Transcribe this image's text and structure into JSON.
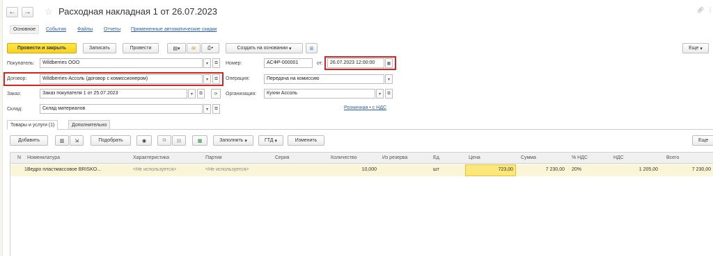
{
  "window": {
    "title": "Расходная накладная 1 от 26.07.2023"
  },
  "tabs": [
    "Основное",
    "События",
    "Файлы",
    "Отчеты",
    "Примененные автоматические скидки"
  ],
  "toolbar": {
    "post_close": "Провести и закрыть",
    "save": "Записать",
    "post": "Провести",
    "create_based": "Создать на основании",
    "more": "Еще"
  },
  "form": {
    "buyer_label": "Покупатель:",
    "buyer_value": "Wildberries ООО",
    "number_label": "Номер:",
    "number_value": "АСФР-000001",
    "from_label": "от:",
    "date_value": "26.07.2023 12:00:00",
    "contract_label": "Договор:",
    "contract_value": "Wildberries-Ассоль (договор с комиссионером)",
    "operation_label": "Операция:",
    "operation_value": "Передача на комиссию",
    "order_label": "Заказ:",
    "order_value": "Заказ покупателя 1 от 25.07.2023",
    "org_label": "Организация:",
    "org_value": "Кухни Ассоль",
    "warehouse_label": "Склад:",
    "warehouse_value": "Склад материалов",
    "price_type_link": "Розничная • с НДС"
  },
  "page_tabs": [
    "Товары и услуги (1)",
    "Дополнительно"
  ],
  "table_toolbar": {
    "add": "Добавить",
    "pick": "Подобрать",
    "fill": "Заполнить",
    "gtd": "ГТД",
    "change": "Изменить",
    "more": "Еще"
  },
  "table": {
    "headers": [
      "N",
      "Номенклатура",
      "Характеристика",
      "Партия",
      "Серия",
      "Количество",
      "Из резерва",
      "Ед.",
      "Цена",
      "Сумма",
      "% НДС",
      "НДС",
      "Всего"
    ],
    "rows": [
      {
        "n": "1",
        "item": "Ведро пластмассовое BRISKO...",
        "characteristic": "<Не используется>",
        "batch": "<Не используется>",
        "series": "",
        "quantity": "10,000",
        "reserve": "",
        "unit": "шт",
        "price": "723,00",
        "sum": "7 230,00",
        "vat_rate": "20%",
        "vat": "1 205,00",
        "total": "7 230,00"
      }
    ]
  },
  "colors": {
    "accent_yellow": "#f7d11e",
    "highlight_red": "#d9221c",
    "row_bg": "#fbf5d7"
  }
}
